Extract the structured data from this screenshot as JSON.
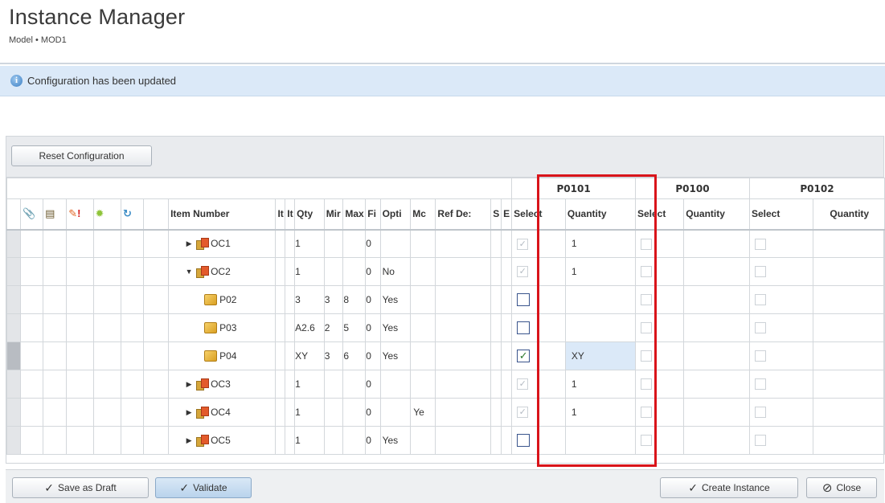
{
  "header": {
    "title": "Instance Manager",
    "subtitle": "Model • MOD1"
  },
  "message": {
    "icon": "info-icon",
    "text": "Configuration has been updated"
  },
  "toolbar": {
    "reset_label": "Reset Configuration"
  },
  "grid": {
    "column_groups": [
      "P0101",
      "P0100",
      "P0102"
    ],
    "header_icons": [
      "attachment-icon",
      "printer-icon",
      "pencil-icon",
      "alert-icon",
      "starburst-icon",
      "refresh-icon"
    ],
    "columns": [
      "Item Number",
      "It",
      "It",
      "Qty",
      "Mir",
      "Max",
      "Fi",
      "Opti",
      "Mc",
      "Ref De:",
      "S",
      "E",
      "Select",
      "Quantity",
      "Select",
      "Quantity",
      "Select",
      "Quantity"
    ],
    "rows": [
      {
        "expander": "collapsed",
        "icon": "option-class-icon",
        "item": "OC1",
        "qty": "1",
        "min": "",
        "max": "",
        "fi": "0",
        "opt": "",
        "mc": "",
        "p0101_select": "checked-disabled",
        "p0101_qty": "1"
      },
      {
        "expander": "expanded",
        "icon": "option-class-icon",
        "item": "OC2",
        "qty": "1",
        "min": "",
        "max": "",
        "fi": "0",
        "opt": "No",
        "mc": "",
        "p0101_select": "checked-disabled",
        "p0101_qty": "1"
      },
      {
        "expander": "none",
        "icon": "part-icon",
        "item": "P02",
        "qty": "3",
        "min": "3",
        "max": "8",
        "fi": "0",
        "opt": "Yes",
        "mc": "",
        "p0101_select": "unchecked",
        "p0101_qty": ""
      },
      {
        "expander": "none",
        "icon": "part-icon",
        "item": "P03",
        "qty": "A2.6",
        "min": "2",
        "max": "5",
        "fi": "0",
        "opt": "Yes",
        "mc": "",
        "p0101_select": "unchecked",
        "p0101_qty": ""
      },
      {
        "expander": "none",
        "icon": "part-icon",
        "item": "P04",
        "qty": "XY",
        "min": "3",
        "max": "6",
        "fi": "0",
        "opt": "Yes",
        "mc": "",
        "p0101_select": "checked",
        "p0101_qty": "XY"
      },
      {
        "expander": "collapsed",
        "icon": "option-class-icon",
        "item": "OC3",
        "qty": "1",
        "min": "",
        "max": "",
        "fi": "0",
        "opt": "",
        "mc": "",
        "p0101_select": "checked-disabled",
        "p0101_qty": "1"
      },
      {
        "expander": "collapsed",
        "icon": "option-class-icon",
        "item": "OC4",
        "qty": "1",
        "min": "",
        "max": "",
        "fi": "0",
        "opt": "",
        "mc": "Ye",
        "p0101_select": "checked-disabled",
        "p0101_qty": "1"
      },
      {
        "expander": "collapsed",
        "icon": "option-class-icon",
        "item": "OC5",
        "qty": "1",
        "min": "",
        "max": "",
        "fi": "0",
        "opt": "Yes",
        "mc": "",
        "p0101_select": "unchecked",
        "p0101_qty": ""
      }
    ]
  },
  "footer": {
    "save_draft_label": "Save as Draft",
    "validate_label": "Validate",
    "create_instance_label": "Create Instance",
    "close_label": "Close"
  }
}
